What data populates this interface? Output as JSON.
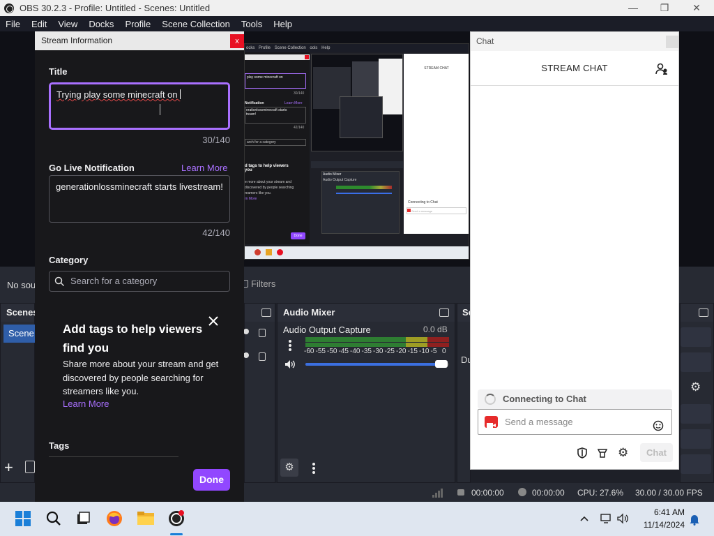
{
  "window": {
    "title": "OBS 30.2.3 - Profile: Untitled - Scenes: Untitled",
    "minimize": "—",
    "maximize": "❐",
    "close": "✕"
  },
  "menu": [
    "File",
    "Edit",
    "View",
    "Docks",
    "Profile",
    "Scene Collection",
    "Tools",
    "Help"
  ],
  "source_bar": {
    "no_source": "No sou",
    "filters": "Filters"
  },
  "scenes_dock": {
    "title": "Scenes",
    "item": "Scene"
  },
  "audio_mixer": {
    "title": "Audio Mixer",
    "source": "Audio Output Capture",
    "level": "0.0 dB",
    "scale": [
      "-60",
      "-55",
      "-50",
      "-45",
      "-40",
      "-35",
      "-30",
      "-25",
      "-20",
      "-15",
      "-10",
      "-5",
      "0"
    ],
    "volume_level": 0.97
  },
  "transitions_dock": {
    "title": "Sc",
    "du": "Du"
  },
  "status": {
    "rec_time": "00:00:00",
    "stream_time": "00:00:00",
    "cpu": "CPU: 27.6%",
    "fps": "30.00 / 30.00 FPS"
  },
  "stream_dialog": {
    "header": "Stream Information",
    "close": "x",
    "title_label": "Title",
    "title_value": "Trying play some minecraft on ",
    "title_count": "30/140",
    "notif_label": "Go Live Notification",
    "learn_more": "Learn More",
    "notif_value": "generationlossminecraft starts livestream!",
    "notif_count": "42/140",
    "category_label": "Category",
    "category_placeholder": "Search for a category",
    "tags_promo_title": "Add tags to help viewers find you",
    "tags_promo_body": "Share more about your stream and get discovered by people searching for streamers like you.",
    "tags_promo_link": "Learn More",
    "tags_label": "Tags",
    "done": "Done"
  },
  "chat": {
    "header": "Chat",
    "title": "STREAM CHAT",
    "status": "Connecting to Chat",
    "input_placeholder": "Send a message",
    "send": "Chat"
  },
  "preview_mini": {
    "chat_title": "STREAM CHAT",
    "connecting": "Connecting to Chat",
    "send": "Send a message",
    "done": "Done",
    "title_text": "play some minecraft on",
    "count1": "30/140",
    "count2": "42/140",
    "notif": "Notification",
    "learn": "Learn More",
    "notif_text": "erationlossminecraft starts",
    "notif_text2": "tream!",
    "cat": "arch for a category",
    "tags_title": "d tags to help viewers",
    "tags_title2": "you",
    "tags_body": "e more about your stream and",
    "tags_body2": "discovered by people searching",
    "tags_body3": "reamers like you.",
    "tags_link": "rn More",
    "audio": "Audio Mixer",
    "audio_src": "Audio Output Capture",
    "menu": [
      "ocks",
      "Profile",
      "Scene Collection",
      "ools",
      "Help"
    ]
  },
  "taskbar": {
    "time": "6:41 AM",
    "date": "11/14/2024"
  }
}
